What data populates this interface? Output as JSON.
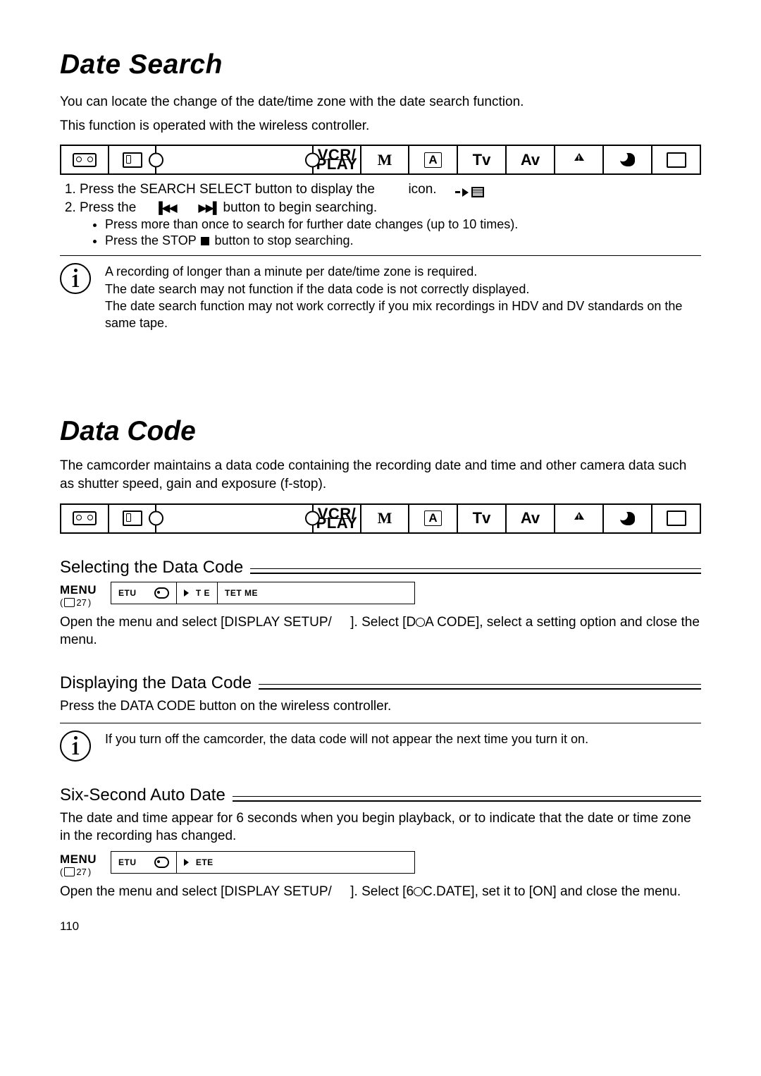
{
  "page_number": "110",
  "headings": {
    "date_search": "Date Search",
    "data_code": "Data Code"
  },
  "date_search": {
    "intro1": "You can locate the change of the date/time zone with the date search function.",
    "intro2": "This function is operated with the wireless controller.",
    "step1_a": "Press the SEARCH SELECT button to display the",
    "step1_b": "icon.",
    "step2_a": "Press the",
    "step2_b": "button to begin searching.",
    "bullet1": "Press more than once to search for further date changes (up to 10 times).",
    "bullet2_a": "Press the STOP",
    "bullet2_b": "button to stop searching.",
    "info1": "A recording of longer than a minute per date/time zone is required.",
    "info2": "The date search may not function if the data code is not correctly displayed.",
    "info3": "The date search function may not work correctly if you mix recordings in HDV and DV standards on the same tape."
  },
  "data_code": {
    "intro": "The camcorder maintains a data code containing the recording date and time and other camera data such as shutter speed, gain and exposure (f-stop).",
    "selecting_heading": "Selecting the Data Code",
    "displaying_heading": "Displaying the Data Code",
    "six_second_heading": "Six-Second Auto Date",
    "selecting_text_a": "Open the menu and select [DISPLAY SETUP/",
    "selecting_text_b": "]. Select [D",
    "selecting_text_c": "A CODE], select a setting option and close the menu.",
    "displaying_text": "Press the DATA CODE button on the wireless controller.",
    "displaying_info": "If you turn off the camcorder, the data code will not appear the next time you turn it on.",
    "six_second_text": "The date and time appear for 6 seconds when you begin playback, or to indicate that the date or time zone in the recording has changed.",
    "six_second_menu_a": "Open the menu and select [DISPLAY SETUP/",
    "six_second_menu_b": "]. Select [6",
    "six_second_menu_c": "C.DATE], set it to [ON] and close the menu."
  },
  "menu_label": {
    "title": "MENU",
    "ref": "27"
  },
  "menu_box1": {
    "seg1": "ETU",
    "seg2": "T E",
    "seg3": "TET ME"
  },
  "menu_box2": {
    "seg1": "ETU",
    "seg2": "ETE"
  },
  "modes": {
    "vcr_top": "VCR/",
    "vcr_bot": "PLAY",
    "m": "M",
    "a": "A",
    "tv": "Tv",
    "av": "Av"
  },
  "icons": {
    "rew": "▐◀◀",
    "ff": "▶▶▌"
  }
}
